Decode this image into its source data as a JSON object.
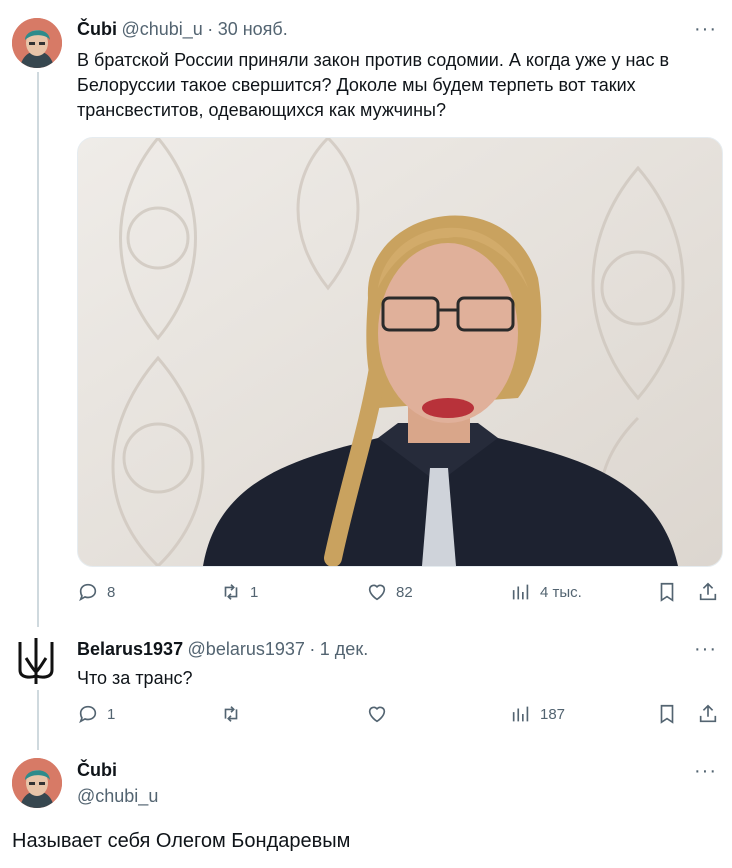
{
  "tweet1": {
    "author": "Čubi",
    "handle": "@chubi_u",
    "sep": "·",
    "date": "30 нояб.",
    "text": "В братской России приняли закон против содомии. А когда уже у нас в Белоруссии такое свершится? Доколе мы будем терпеть вот таких трансвеститов, одевающихся как мужчины?",
    "replies": "8",
    "reposts": "1",
    "likes": "82",
    "views": "4 тыс."
  },
  "tweet2": {
    "author": "Belarus1937",
    "handle": "@belarus1937",
    "sep": "·",
    "date": "1 дек.",
    "text": "Что за транс?",
    "replies": "1",
    "views": "187"
  },
  "tweet3": {
    "author": "Čubi",
    "handle": "@chubi_u",
    "text": "Называет себя Олегом Бондаревым"
  },
  "more_glyph": "···",
  "colors": {
    "text": "#0f1419",
    "muted": "#536471",
    "line": "#cfd9de"
  }
}
